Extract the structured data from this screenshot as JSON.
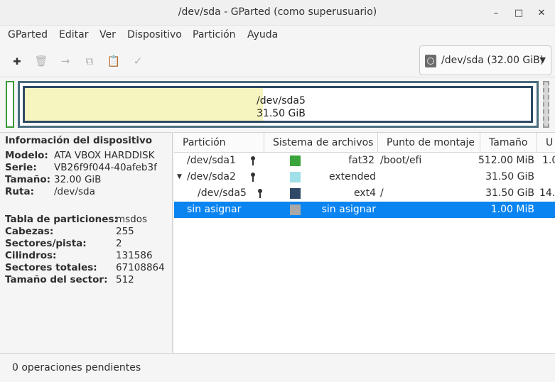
{
  "window": {
    "title": "/dev/sda - GParted (como superusuario)",
    "minimize_glyph": "–",
    "maximize_glyph": "□",
    "close_glyph": "✕"
  },
  "menu": [
    "GParted",
    "Editar",
    "Ver",
    "Dispositivo",
    "Partición",
    "Ayuda"
  ],
  "toolbar": {
    "icons": [
      "new-partition-icon",
      "delete-icon",
      "resize-move-icon",
      "copy-icon",
      "paste-icon",
      "apply-icon"
    ],
    "glyphs": [
      "🞦",
      "🗑",
      "→",
      "⧉",
      "📋",
      "✓"
    ]
  },
  "device_selector": {
    "label": "/dev/sda (32.00 GiB)",
    "caret": "▼"
  },
  "visual": {
    "name": "/dev/sda5",
    "size": "31.50 GiB",
    "used_fraction": 0.47
  },
  "info": {
    "title": "Información del dispositivo",
    "rows": [
      {
        "key": "Modelo:",
        "value": "ATA VBOX HARDDISK"
      },
      {
        "key": "Serie:",
        "value": "VB26f9f044-40afeb3f"
      },
      {
        "key": "Tamaño:",
        "value": "32.00 GiB"
      },
      {
        "key": "Ruta:",
        "value": "/dev/sda"
      }
    ],
    "rows2": [
      {
        "key": "Tabla de particiones:",
        "value": "msdos"
      },
      {
        "key": "Cabezas:",
        "value": "255"
      },
      {
        "key": "Sectores/pista:",
        "value": "2"
      },
      {
        "key": "Cilindros:",
        "value": "131586"
      },
      {
        "key": "Sectores totales:",
        "value": "67108864"
      },
      {
        "key": "Tamaño del sector:",
        "value": "512"
      }
    ]
  },
  "table": {
    "columns": [
      "Partición",
      "Sistema de archivos",
      "Punto de montaje",
      "Tamaño",
      "U"
    ],
    "rows": [
      {
        "partition": "/dev/sda1",
        "fs": "fat32",
        "mount": "/boot/efi",
        "size": "512.00 MiB",
        "used": "1.0",
        "color": "#3aa53a",
        "locked": true
      },
      {
        "partition": "/dev/sda2",
        "fs": "extended",
        "mount": "",
        "size": "31.50 GiB",
        "used": "",
        "color": "#a0e0e8",
        "locked": true,
        "expander": "▼"
      },
      {
        "partition": "/dev/sda5",
        "fs": "ext4",
        "mount": "/",
        "size": "31.50 GiB",
        "used": "14.",
        "color": "#2e4a66",
        "locked": true
      },
      {
        "partition": "sin asignar",
        "fs": "sin asignar",
        "mount": "",
        "size": "1.00 MiB",
        "used": "",
        "color": "#a8a8a8",
        "locked": false
      }
    ]
  },
  "status": {
    "text": "0 operaciones pendientes"
  },
  "colors": {
    "accent": "#0a84f0",
    "unalloc_border": "#9a9a9a",
    "used_fill": "#f7f5bf"
  }
}
